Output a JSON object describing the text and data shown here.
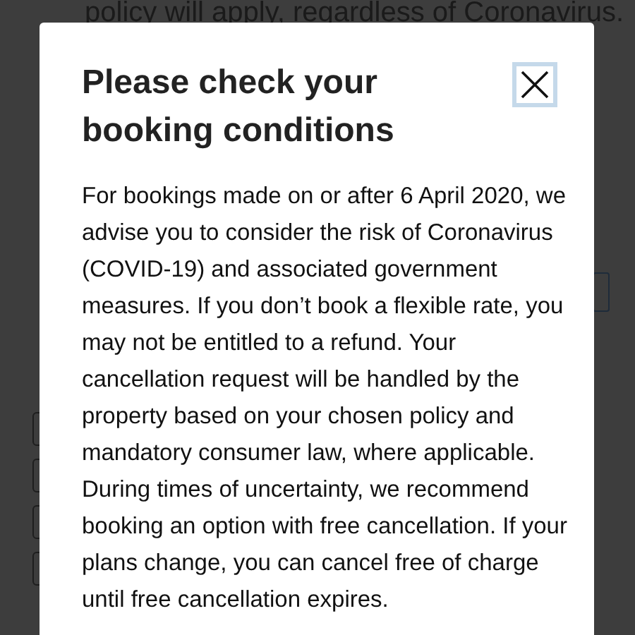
{
  "background": {
    "text": "policy will apply, regardless of Coronavirus."
  },
  "dialog": {
    "title": "Please check your booking conditions",
    "body": "For bookings made on or after 6 April 2020, we advise you to consider the risk of Coronavirus (COVID-19) and associated government measures. If you don’t book a flexible rate, you may not be entitled to a refund. Your cancellation request will be handled by the property based on your chosen policy and mandatory consumer law, where applicable. During times of uncertainty, we recommend booking an option with free cancellation. If your plans change, you can cancel free of charge until free cancellation expires."
  }
}
